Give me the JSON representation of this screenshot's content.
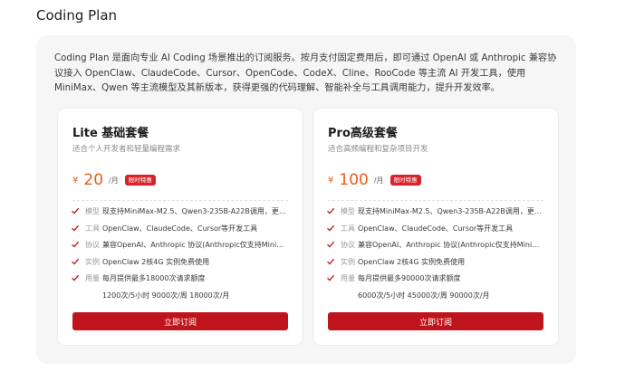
{
  "page": {
    "title": "Coding Plan"
  },
  "intro": "Coding Plan 是面向专业 AI Coding 场景推出的订阅服务。按月支付固定费用后，即可通过 OpenAI 或 Anthropic 兼容协议接入 OpenClaw、ClaudeCode、Cursor、OpenCode、CodeX、Cline、RooCode 等主流 AI 开发工具，使用 MiniMax、Qwen 等主流模型及其新版本，获得更强的代码理解、智能补全与工具调用能力，提升开发效率。",
  "plans": [
    {
      "title": "Lite 基础套餐",
      "subtitle": "适合个人开发者和轻量编程需求",
      "currency": "¥",
      "price": "20",
      "unit": "/月",
      "badge": "限时特惠",
      "features": [
        {
          "label": "模型",
          "text": "现支持MiniMax-M2.5、Qwen3-235B-A22B调用，更多..."
        },
        {
          "label": "工具",
          "text": "OpenClaw、ClaudeCode、Cursor等开发工具"
        },
        {
          "label": "协议",
          "text": "兼容OpenAI、Anthropic 协议(Anthropic仅支持MiniMax-..."
        },
        {
          "label": "实例",
          "text": "OpenClaw 2核4G 实例免费使用"
        },
        {
          "label": "用量",
          "text": "每月提供最多18000次请求额度"
        }
      ],
      "quota_detail": "1200次/5小时 9000次/周 18000次/月",
      "button": "立即订阅"
    },
    {
      "title": "Pro高级套餐",
      "subtitle": "适合高频编程和复杂项目开发",
      "currency": "¥",
      "price": "100",
      "unit": "/月",
      "badge": "限时特惠",
      "features": [
        {
          "label": "模型",
          "text": "现支持MiniMax-M2.5、Qwen3-235B-A22B调用，更多..."
        },
        {
          "label": "工具",
          "text": "OpenClaw、ClaudeCode、Cursor等开发工具"
        },
        {
          "label": "协议",
          "text": "兼容OpenAI、Anthropic 协议(Anthropic仅支持MiniMax-..."
        },
        {
          "label": "实例",
          "text": "OpenClaw 2核4G 实例免费使用"
        },
        {
          "label": "用量",
          "text": "每月提供最多90000次请求额度"
        }
      ],
      "quota_detail": "6000次/5小时 45000次/周 90000次/月",
      "button": "立即订阅"
    }
  ],
  "icons": {
    "feature": "check-icon"
  },
  "colors": {
    "accent": "#c0141c",
    "price": "#e85c1c",
    "badge": "#d8232a",
    "check": "#c0141c"
  }
}
